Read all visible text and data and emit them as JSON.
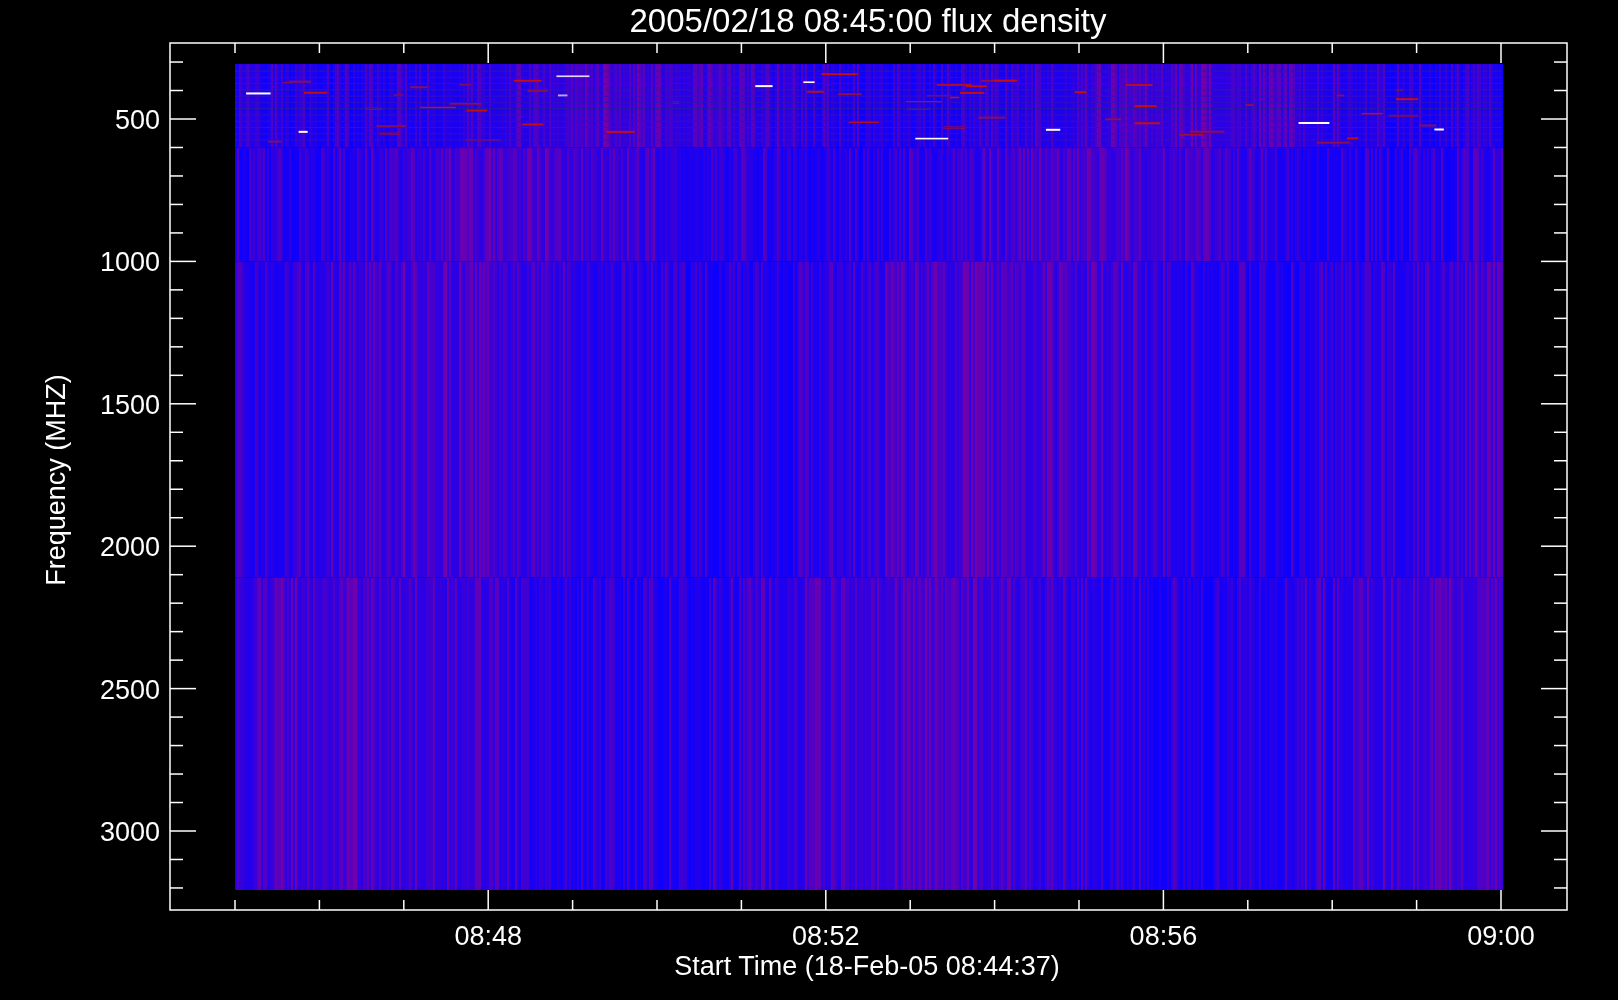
{
  "plot": {
    "title": "2005/02/18 08:45:00 flux density",
    "ylabel": "Frequency (MHZ)",
    "xlabel": "Start Time (18-Feb-05 08:44:37)",
    "yticks": [
      "500",
      "1000",
      "1500",
      "2000",
      "2500",
      "3000"
    ],
    "xticks": [
      "08:48",
      "08:52",
      "08:56",
      "09:00"
    ]
  }
}
